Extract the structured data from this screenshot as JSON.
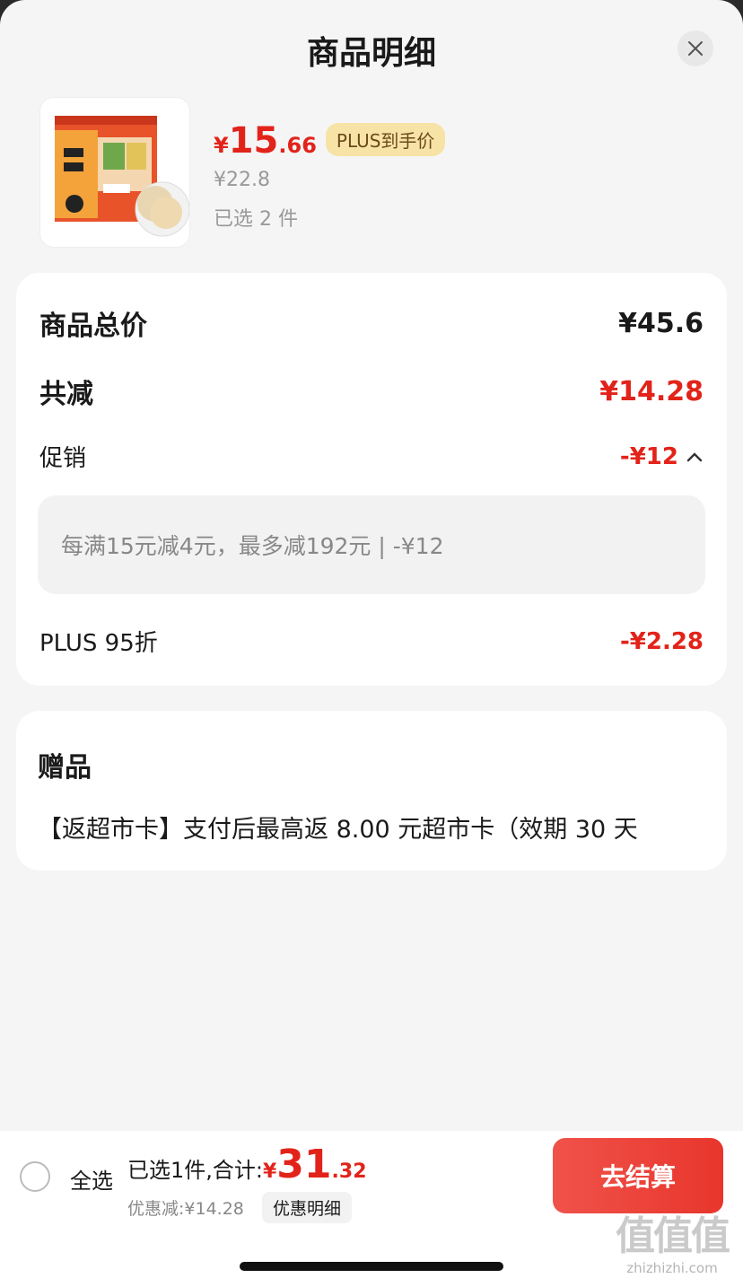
{
  "header": {
    "title": "商品明细"
  },
  "product": {
    "price_yen": "¥",
    "price_int": "15",
    "price_dec": ".66",
    "plus_badge": "PLUS到手价",
    "original_price": "¥22.8",
    "selected_count": "已选 2 件",
    "image_alt": "旺旺雪饼"
  },
  "price_detail": {
    "total_label": "商品总价",
    "total_value": "¥45.6",
    "reduced_label": "共减",
    "reduced_value": "¥14.28",
    "promo_label": "促销",
    "promo_value": "-¥12",
    "promo_detail": "每满15元减4元，最多减192元 | -¥12",
    "plus_label": "PLUS 95折",
    "plus_value": "-¥2.28"
  },
  "gift": {
    "title": "赠品",
    "text": "【返超市卡】支付后最高返 8.00 元超市卡（效期 30 天"
  },
  "bottom_bar": {
    "select_all": "全选",
    "total_label": "已选1件,合计:",
    "total_yen": "¥",
    "total_int": "31",
    "total_dec": ".32",
    "discount": "优惠减:¥14.28",
    "detail_link": "优惠明细",
    "checkout": "去结算"
  },
  "watermark": {
    "glyphs": "值值值",
    "site": "zhizhizhi.com"
  },
  "colors": {
    "accent_red": "#e2231a",
    "plus_gold": "#f7e3a6",
    "background": "#f5f5f5"
  }
}
